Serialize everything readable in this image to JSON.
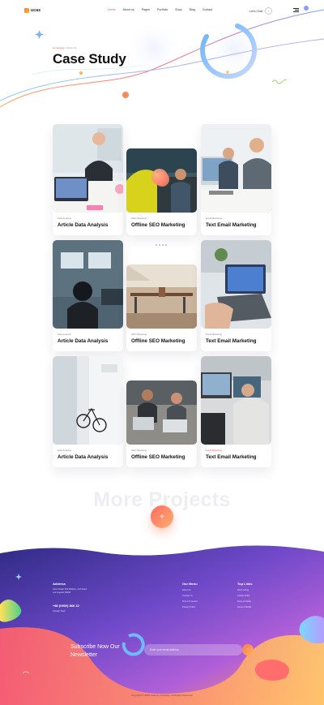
{
  "header": {
    "logo": "ucas",
    "nav": [
      "Home",
      "About us",
      "Pages",
      "Portfolio",
      "Shop",
      "Blog",
      "Contact"
    ],
    "active_nav": "Home",
    "cta": "Let's Chat"
  },
  "hero": {
    "breadcrumb_home": "Homepage",
    "breadcrumb_sep": " / ",
    "breadcrumb_current": "About Us",
    "title": "Case Study"
  },
  "cards": [
    {
      "category": "Data Analysis",
      "title": "Article Data Analysis"
    },
    {
      "category": "SEO Marketing",
      "title": "Offline SEO Marketing"
    },
    {
      "category": "Email Marketing",
      "title": "Text Email Marketing"
    },
    {
      "category": "Data Analysis",
      "title": "Article Data Analysis"
    },
    {
      "category": "SEO Marketing",
      "title": "Offline SEO Marketing"
    },
    {
      "category": "Email Marketing",
      "title": "Text Email Marketing"
    },
    {
      "category": "Data Analysis",
      "title": "Article Data Analysis"
    },
    {
      "category": "SEO Marketing",
      "title": "Offline SEO Marketing"
    },
    {
      "category": "Email Marketing",
      "title": "Text Email Marketing"
    }
  ],
  "more_projects": "More Projects",
  "footer": {
    "address_title": "Address",
    "address_line1": "Ucas Studio 394 Wilshire, 2nd Street",
    "address_line2": "Los Angeles 90028",
    "phone": "+86 (0900) 866 22",
    "contact_link": "Contact Team",
    "menu_title": "Our Menu",
    "menu_items": [
      "About Us",
      "Contact Us",
      "Terms of service",
      "Privacy Policy"
    ],
    "links_title": "Top Links",
    "links_items": [
      "We're Hiring",
      "Cookie Policy",
      "News & Media",
      "Home & Media"
    ],
    "subscribe_title_1": "Subscribe Now Our",
    "subscribe_title_2": "Newsletter",
    "subscribe_placeholder": "Enter your email address...",
    "copyright": "Copyright © 2022 Ucas by company. All Rights Reserved."
  },
  "colors": {
    "accent": "#ff5a4e",
    "footer_top": "#3b2c8f",
    "footer_mid": "#7b4fd1",
    "footer_bottom": "#ff8a6a"
  }
}
